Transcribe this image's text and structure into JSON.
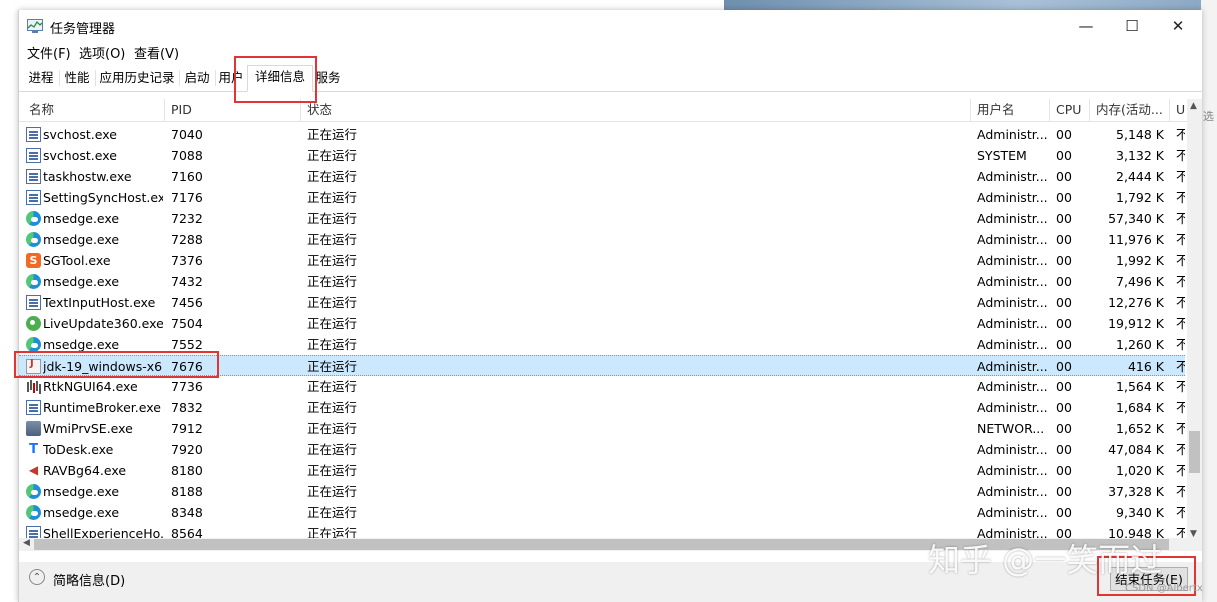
{
  "window": {
    "title": "任务管理器",
    "controls": {
      "minimize": "—",
      "maximize": "☐",
      "close": "✕"
    }
  },
  "menu": [
    {
      "label": "文件(F)"
    },
    {
      "label": "选项(O)"
    },
    {
      "label": "查看(V)"
    }
  ],
  "tabs": [
    {
      "label": "进程"
    },
    {
      "label": "性能"
    },
    {
      "label": "应用历史记录"
    },
    {
      "label": "启动"
    },
    {
      "label": "用户"
    },
    {
      "label": "详细信息",
      "active": true
    },
    {
      "label": "服务"
    }
  ],
  "columns": {
    "name": "名称",
    "pid": "PID",
    "status": "状态",
    "user": "用户名",
    "cpu": "CPU",
    "memory": "内存(活动...",
    "uac": "U"
  },
  "rows": [
    {
      "icon": "service-icon",
      "name": "svchost.exe",
      "pid": "7040",
      "status": "正在运行",
      "user": "Administr...",
      "cpu": "00",
      "memory": "5,148 K",
      "uac": "不"
    },
    {
      "icon": "service-icon",
      "name": "svchost.exe",
      "pid": "7088",
      "status": "正在运行",
      "user": "SYSTEM",
      "cpu": "00",
      "memory": "3,132 K",
      "uac": "不"
    },
    {
      "icon": "service-icon",
      "name": "taskhostw.exe",
      "pid": "7160",
      "status": "正在运行",
      "user": "Administr...",
      "cpu": "00",
      "memory": "2,444 K",
      "uac": "不"
    },
    {
      "icon": "service-icon",
      "name": "SettingSyncHost.exe",
      "pid": "7176",
      "status": "正在运行",
      "user": "Administr...",
      "cpu": "00",
      "memory": "1,792 K",
      "uac": "不"
    },
    {
      "icon": "edge-icon",
      "name": "msedge.exe",
      "pid": "7232",
      "status": "正在运行",
      "user": "Administr...",
      "cpu": "00",
      "memory": "57,340 K",
      "uac": "不"
    },
    {
      "icon": "edge-icon",
      "name": "msedge.exe",
      "pid": "7288",
      "status": "正在运行",
      "user": "Administr...",
      "cpu": "00",
      "memory": "11,976 K",
      "uac": "不"
    },
    {
      "icon": "sogou-icon",
      "name": "SGTool.exe",
      "pid": "7376",
      "status": "正在运行",
      "user": "Administr...",
      "cpu": "00",
      "memory": "1,992 K",
      "uac": "不"
    },
    {
      "icon": "edge-icon",
      "name": "msedge.exe",
      "pid": "7432",
      "status": "正在运行",
      "user": "Administr...",
      "cpu": "00",
      "memory": "7,496 K",
      "uac": "不"
    },
    {
      "icon": "service-icon",
      "name": "TextInputHost.exe",
      "pid": "7456",
      "status": "正在运行",
      "user": "Administr...",
      "cpu": "00",
      "memory": "12,276 K",
      "uac": "不"
    },
    {
      "icon": "liveupdate-icon",
      "name": "LiveUpdate360.exe",
      "pid": "7504",
      "status": "正在运行",
      "user": "Administr...",
      "cpu": "00",
      "memory": "19,912 K",
      "uac": "不"
    },
    {
      "icon": "edge-icon",
      "name": "msedge.exe",
      "pid": "7552",
      "status": "正在运行",
      "user": "Administr...",
      "cpu": "00",
      "memory": "1,260 K",
      "uac": "不"
    },
    {
      "icon": "java-installer-icon",
      "name": "jdk-19_windows-x6...",
      "pid": "7676",
      "status": "正在运行",
      "user": "Administr...",
      "cpu": "00",
      "memory": "416 K",
      "uac": "不",
      "selected": true
    },
    {
      "icon": "realtek-audio-icon",
      "name": "RtkNGUI64.exe",
      "pid": "7736",
      "status": "正在运行",
      "user": "Administr...",
      "cpu": "00",
      "memory": "1,564 K",
      "uac": "不"
    },
    {
      "icon": "service-icon",
      "name": "RuntimeBroker.exe",
      "pid": "7832",
      "status": "正在运行",
      "user": "Administr...",
      "cpu": "00",
      "memory": "1,684 K",
      "uac": "不"
    },
    {
      "icon": "wmi-icon",
      "name": "WmiPrvSE.exe",
      "pid": "7912",
      "status": "正在运行",
      "user": "NETWOR...",
      "cpu": "00",
      "memory": "1,652 K",
      "uac": "不"
    },
    {
      "icon": "todesk-icon",
      "name": "ToDesk.exe",
      "pid": "7920",
      "status": "正在运行",
      "user": "Administr...",
      "cpu": "00",
      "memory": "47,084 K",
      "uac": "不"
    },
    {
      "icon": "speaker-icon",
      "name": "RAVBg64.exe",
      "pid": "8180",
      "status": "正在运行",
      "user": "Administr...",
      "cpu": "00",
      "memory": "1,020 K",
      "uac": "不"
    },
    {
      "icon": "edge-icon",
      "name": "msedge.exe",
      "pid": "8188",
      "status": "正在运行",
      "user": "Administr...",
      "cpu": "00",
      "memory": "37,328 K",
      "uac": "不"
    },
    {
      "icon": "edge-icon",
      "name": "msedge.exe",
      "pid": "8348",
      "status": "正在运行",
      "user": "Administr...",
      "cpu": "00",
      "memory": "9,340 K",
      "uac": "不"
    },
    {
      "icon": "service-icon",
      "name": "ShellExperienceHo...",
      "pid": "8564",
      "status": "正在运行",
      "user": "Administr...",
      "cpu": "00",
      "memory": "10,948 K",
      "uac": "不"
    }
  ],
  "footer": {
    "fewer_details": "简略信息(D)",
    "end_task": "结束任务(E)"
  },
  "watermark": "知乎 @一笑而过",
  "watermark_small": "CSDN @Albertx",
  "background_text": "选"
}
